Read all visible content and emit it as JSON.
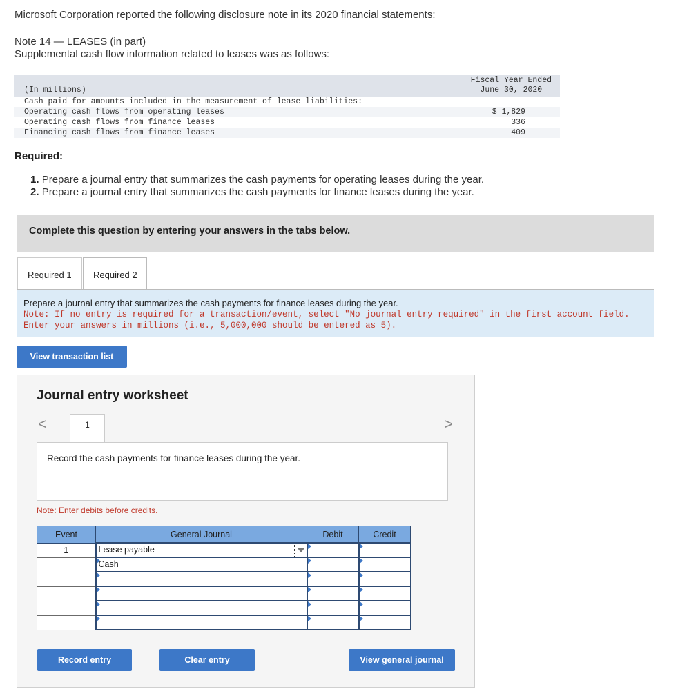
{
  "intro": "Microsoft Corporation reported the following disclosure note in its 2020 financial statements:",
  "note": {
    "title": "Note 14 — LEASES (in part)",
    "subtitle": "Supplemental cash flow information related to leases was as follows:"
  },
  "financial_table": {
    "units": "(In millions)",
    "period_line1": "Fiscal Year Ended",
    "period_line2": "June 30, 2020",
    "rows": [
      {
        "label": "Cash paid for amounts included in the measurement of lease liabilities:",
        "value": ""
      },
      {
        "label": "Operating cash flows from operating leases",
        "value": "$ 1,829"
      },
      {
        "label": "Operating cash flows from finance leases",
        "value": "336"
      },
      {
        "label": "Financing cash flows from finance leases",
        "value": "409"
      }
    ]
  },
  "required": {
    "heading": "Required:",
    "items": [
      {
        "num": "1.",
        "text": "Prepare a journal entry that summarizes the cash payments for operating leases during the year."
      },
      {
        "num": "2.",
        "text": "Prepare a journal entry that summarizes the cash payments for finance leases during the year."
      }
    ]
  },
  "complete_prompt": "Complete this question by entering your answers in the tabs below.",
  "tabs": [
    {
      "label": "Required 1"
    },
    {
      "label": "Required 2"
    }
  ],
  "instructions": {
    "line1": "Prepare a journal entry that summarizes the cash payments for finance leases during the year.",
    "note": "Note: If no entry is required for a transaction/event, select \"No journal entry required\" in the first account field. Enter your answers in millions (i.e., 5,000,000 should be entered as 5)."
  },
  "buttons": {
    "view_transactions": "View transaction list",
    "record": "Record entry",
    "clear": "Clear entry",
    "view_journal": "View general journal"
  },
  "worksheet": {
    "title": "Journal entry worksheet",
    "page": "1",
    "prev_icon": "<",
    "next_icon": ">",
    "description": "Record the cash payments for finance leases during the year.",
    "debit_note": "Note: Enter debits before credits.",
    "columns": [
      "Event",
      "General Journal",
      "Debit",
      "Credit"
    ],
    "rows": [
      {
        "event": "1",
        "account": "Lease payable",
        "debit": "",
        "credit": ""
      },
      {
        "event": "",
        "account": "Cash",
        "debit": "",
        "credit": ""
      },
      {
        "event": "",
        "account": "",
        "debit": "",
        "credit": ""
      },
      {
        "event": "",
        "account": "",
        "debit": "",
        "credit": ""
      },
      {
        "event": "",
        "account": "",
        "debit": "",
        "credit": ""
      },
      {
        "event": "",
        "account": "",
        "debit": "",
        "credit": ""
      }
    ]
  }
}
